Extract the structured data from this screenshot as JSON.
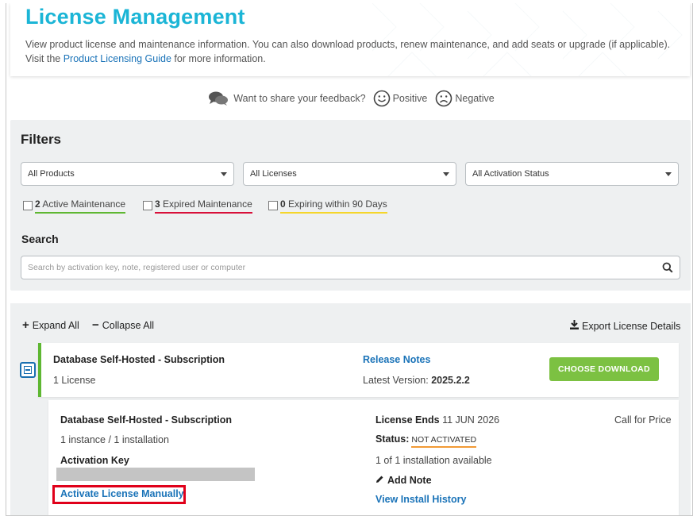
{
  "header": {
    "title": "License Management",
    "description_before": "View product license and maintenance information. You can also download products, renew maintenance, and add seats or upgrade (if applicable). Visit the ",
    "guide_link": "Product Licensing Guide",
    "description_after": " for more information."
  },
  "feedback": {
    "prompt": "Want to share your feedback?",
    "positive": "Positive",
    "negative": "Negative"
  },
  "filters": {
    "title": "Filters",
    "selects": [
      "All Products",
      "All Licenses",
      "All Activation Status"
    ],
    "checkboxes": [
      {
        "count": "2",
        "label": "Active Maintenance",
        "color": "#5eb732"
      },
      {
        "count": "3",
        "label": "Expired Maintenance",
        "color": "#d8103a"
      },
      {
        "count": "0",
        "label": "Expiring within 90 Days",
        "color": "#f5d62b"
      }
    ],
    "search_title": "Search",
    "search_placeholder": "Search by activation key, note, registered user or computer"
  },
  "toolbar": {
    "expand_all": "Expand All",
    "collapse_all": "Collapse All",
    "export": "Export License Details"
  },
  "product": {
    "name": "Database Self-Hosted - Subscription",
    "license_count": "1 License",
    "release_notes": "Release Notes",
    "latest_version_label": "Latest Version:",
    "latest_version": "2025.2.2",
    "download_button": "CHOOSE DOWNLOAD"
  },
  "license": {
    "name": "Database Self-Hosted - Subscription",
    "instances": "1 instance / 1 installation",
    "activation_key_label": "Activation Key",
    "activate_manually": "Activate License Manually",
    "ends_label": "License Ends",
    "ends_date": "11 JUN 2026",
    "status_label": "Status:",
    "status_value": "NOT ACTIVATED",
    "installations_available": "1 of 1 installation available",
    "add_note": "Add Note",
    "view_history": "View Install History",
    "price": "Call for Price"
  },
  "colors": {
    "brand_title": "#1bb5d6",
    "link": "#1a73b8",
    "download_button": "#7cc142",
    "highlight_box": "#e0001a"
  }
}
